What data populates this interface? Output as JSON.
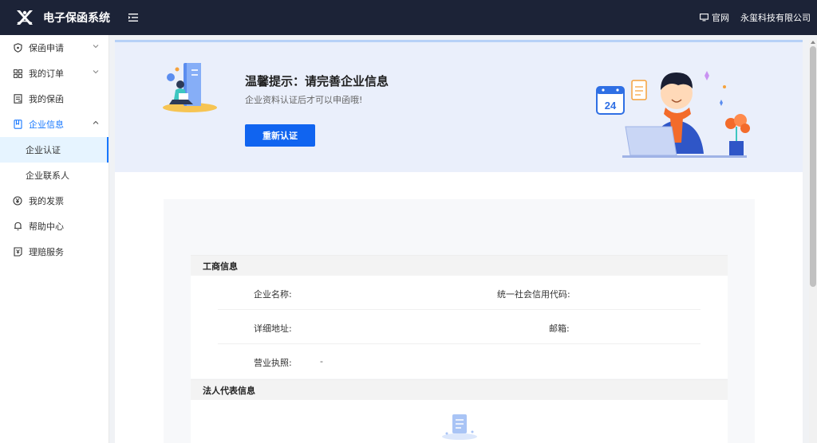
{
  "header": {
    "app_title": "电子保函系统",
    "official_site": "官网",
    "company_name": "永玺科技有限公司"
  },
  "sidebar": {
    "items": [
      {
        "label": "保函申请",
        "icon": "shield-icon",
        "has_submenu": true
      },
      {
        "label": "我的订单",
        "icon": "grid-icon",
        "has_submenu": true
      },
      {
        "label": "我的保函",
        "icon": "document-icon",
        "has_submenu": false
      },
      {
        "label": "企业信息",
        "icon": "book-icon",
        "has_submenu": true,
        "expanded": true,
        "active": true,
        "children": [
          {
            "label": "企业认证",
            "selected": true
          },
          {
            "label": "企业联系人",
            "selected": false
          }
        ]
      },
      {
        "label": "我的发票",
        "icon": "yen-icon",
        "has_submenu": false
      },
      {
        "label": "帮助中心",
        "icon": "bell-icon",
        "has_submenu": false
      },
      {
        "label": "理赔服务",
        "icon": "claim-icon",
        "has_submenu": false
      }
    ]
  },
  "banner": {
    "title": "温馨提示：请完善企业信息",
    "subtitle": "企业资料认证后才可以申函哦!",
    "button_label": "重新认证",
    "calendar_day": "24"
  },
  "business_info": {
    "title": "工商信息",
    "company_name_label": "企业名称:",
    "credit_code_label": "统一社会信用代码:",
    "address_label": "详细地址:",
    "email_label": "邮箱:",
    "license_label": "营业执照:",
    "license_value": "-"
  },
  "legal_rep": {
    "title": "法人代表信息"
  },
  "colors": {
    "topbar": "#1c2337",
    "accent": "#1677ff",
    "button": "#1064f0",
    "banner_bg": "#eaeffb"
  }
}
